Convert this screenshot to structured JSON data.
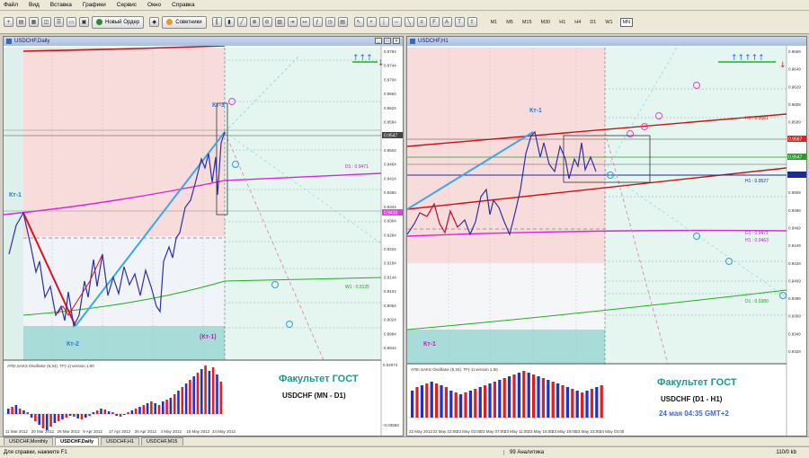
{
  "menu": [
    "Файл",
    "Вид",
    "Вставка",
    "Графики",
    "Сервис",
    "Окно",
    "Справка"
  ],
  "toolbar": {
    "new_order": "Новый Ордер",
    "advisors": "Советники",
    "timeframes": [
      "M1",
      "M5",
      "M15",
      "M30",
      "H1",
      "H4",
      "D1",
      "W1",
      "MN"
    ],
    "selected_timeframe": "MN"
  },
  "left_chart": {
    "title": "USDCHF,Daily",
    "price_axis": [
      "0.9784",
      "0.9744",
      "0.9704",
      "0.9664",
      "0.9624",
      "0.9584",
      "0.9544",
      "0.9504",
      "0.9464",
      "0.9424",
      "0.9384",
      "0.9344",
      "0.9304",
      "0.9264",
      "0.9224",
      "0.9184",
      "0.9144",
      "0.9104",
      "0.9064",
      "0.9024",
      "0.8984",
      "0.8944"
    ],
    "current_price": "0.9547",
    "bid_tag": "0.9548",
    "magenta_tag": "0.9410",
    "labels": {
      "kt1_left": "Кт-1",
      "kt2": "Кт-2",
      "kt3": "Кт-3",
      "kt1_paren": "(Кт-1)"
    },
    "level_labels": {
      "d1": "D1 : 0.9471",
      "w1": "W1 : 0.9135"
    },
    "dates": [
      "11 Mar 2012",
      "20 Mar 2012",
      "29 Mar 2012",
      "9 Apr 2012",
      "17 Apr 2012",
      "26 Apr 2012",
      "4 May 2012",
      "15 May 2012",
      "24 May 2012"
    ],
    "oscillator": {
      "title": "ATEI.SAKS Oscillator (5,34). TF(-1)  version 1.00",
      "scale_top": "0.02074",
      "scale_bottom": "-0.03583"
    },
    "watermark": "Факультет ГОСТ",
    "subtitle": "USDCHF (MN - D1)"
  },
  "right_chart": {
    "title": "USDCHF,H1",
    "price_axis": [
      "0.9669",
      "0.9649",
      "0.9629",
      "0.9609",
      "0.9589",
      "0.9569",
      "0.9549",
      "0.9529",
      "0.9509",
      "0.9489",
      "0.9469",
      "0.9449",
      "0.9429",
      "0.9409",
      "0.9389",
      "0.9369",
      "0.9349",
      "0.9329"
    ],
    "current_price": "0.9547",
    "red_tag": "0.9567",
    "labels": {
      "kt1_top": "Кт-1",
      "kt1_bottom": "Кт-1"
    },
    "level_labels": {
      "h1_top": "H1 : 0.9581",
      "h1_mid": "H1 : 0.9527",
      "d1": "D1 : 0.9471",
      "h1_low": "H1 : 0.9463",
      "d1_low": "D1 : 0.9380"
    },
    "dates": [
      "22 May 2012",
      "22 May 23:00",
      "23 May 03:00",
      "23 May 07:00",
      "23 May 11:00",
      "23 May 15:00",
      "23 May 19:00",
      "23 May 23:00",
      "24 May 03:00"
    ],
    "oscillator": {
      "title": "ATEI.SAKS Oscillator (5,34). TF(-1)  version 1.00"
    },
    "watermark": "Факультет ГОСТ",
    "subtitle": "USDCHF (D1 - H1)",
    "timestamp": "24 мая 04:35 GMT+2"
  },
  "tabs": [
    "USDCHF,Monthly",
    "USDCHF,Daily",
    "USDCHF,H1",
    "USDCHF,M15"
  ],
  "active_tab": "USDCHF,Daily",
  "status": {
    "help": "Для справки, нажмите F1",
    "profile": "99 Аналитика",
    "traffic": "110/0 kb"
  },
  "colors": {
    "up_arrow": "#1a6cff",
    "down_arrow": "#e02020",
    "watermark": "#1a9a8a",
    "timestamp": "#3a6ad0",
    "kt_label": "#2a7ad0",
    "kt_paren": "#c020c0"
  }
}
